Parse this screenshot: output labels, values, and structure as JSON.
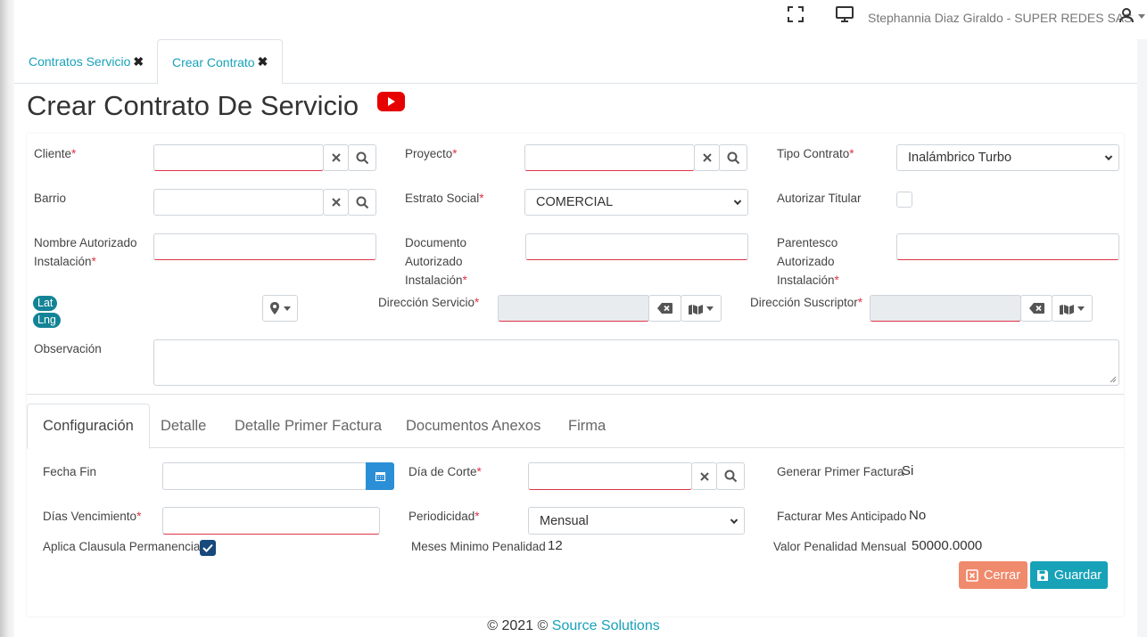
{
  "topbar": {
    "user_label": "Stephannia Diaz Giraldo - SUPER REDES SAS",
    "icons": [
      "fullscreen-icon",
      "monitor-icon",
      "user-icon",
      "caret-down-icon"
    ]
  },
  "top_tabs": [
    {
      "label": "Contratos Servicio",
      "close": "✖"
    },
    {
      "label": "Crear Contrato",
      "close": "✖"
    }
  ],
  "page": {
    "title": "Crear Contrato De Servicio"
  },
  "form": {
    "cliente_label": "Cliente",
    "proyecto_label": "Proyecto",
    "tipo_contrato_label": "Tipo Contrato",
    "tipo_contrato_value": "Inalámbrico Turbo",
    "barrio_label": "Barrio",
    "estrato_label": "Estrato Social",
    "estrato_value": "COMERCIAL",
    "autorizar_label": "Autorizar Titular",
    "nombre_aut_line1": "Nombre Autorizado",
    "nombre_aut_line2": "Instalación",
    "doc_aut_line1": "Documento",
    "doc_aut_line2": "Autorizado",
    "doc_aut_line3": "Instalación",
    "parentesco_line1": "Parentesco",
    "parentesco_line2": "Autorizado",
    "parentesco_line3": "Instalación",
    "lat_label": "Lat",
    "lng_label": "Lng",
    "dir_servicio_label": "Dirección Servicio",
    "dir_suscriptor_label": "Dirección Suscriptor",
    "observacion_label": "Observación",
    "required_mark": "*"
  },
  "tabs": [
    {
      "label": "Configuración"
    },
    {
      "label": "Detalle"
    },
    {
      "label": "Detalle Primer Factura"
    },
    {
      "label": "Documentos Anexos"
    },
    {
      "label": "Firma"
    }
  ],
  "config": {
    "fecha_fin_label": "Fecha Fin",
    "dia_corte_label": "Día de Corte",
    "generar_label": "Generar Primer Factura",
    "generar_value": "Si",
    "dias_venc_label": "Días Vencimiento",
    "periodicidad_label": "Periodicidad",
    "periodicidad_value": "Mensual",
    "facturar_label": "Facturar Mes Anticipado",
    "facturar_value": "No",
    "clausula_label": "Aplica Clausula Permanencia",
    "clausula_checked": true,
    "meses_label": "Meses Minimo Penalidad",
    "meses_value": "12",
    "valor_label": "Valor Penalidad Mensual",
    "valor_value": "50000.0000"
  },
  "actions": {
    "cerrar": "Cerrar",
    "guardar": "Guardar"
  },
  "colors": {
    "accent": "#17a2b8",
    "danger_soft": "#f08a6c",
    "primary_blue": "#2a8fd6",
    "required": "#dc3545"
  },
  "footer": {
    "copyright": "© 2021 © ",
    "company": "Source Solutions"
  }
}
